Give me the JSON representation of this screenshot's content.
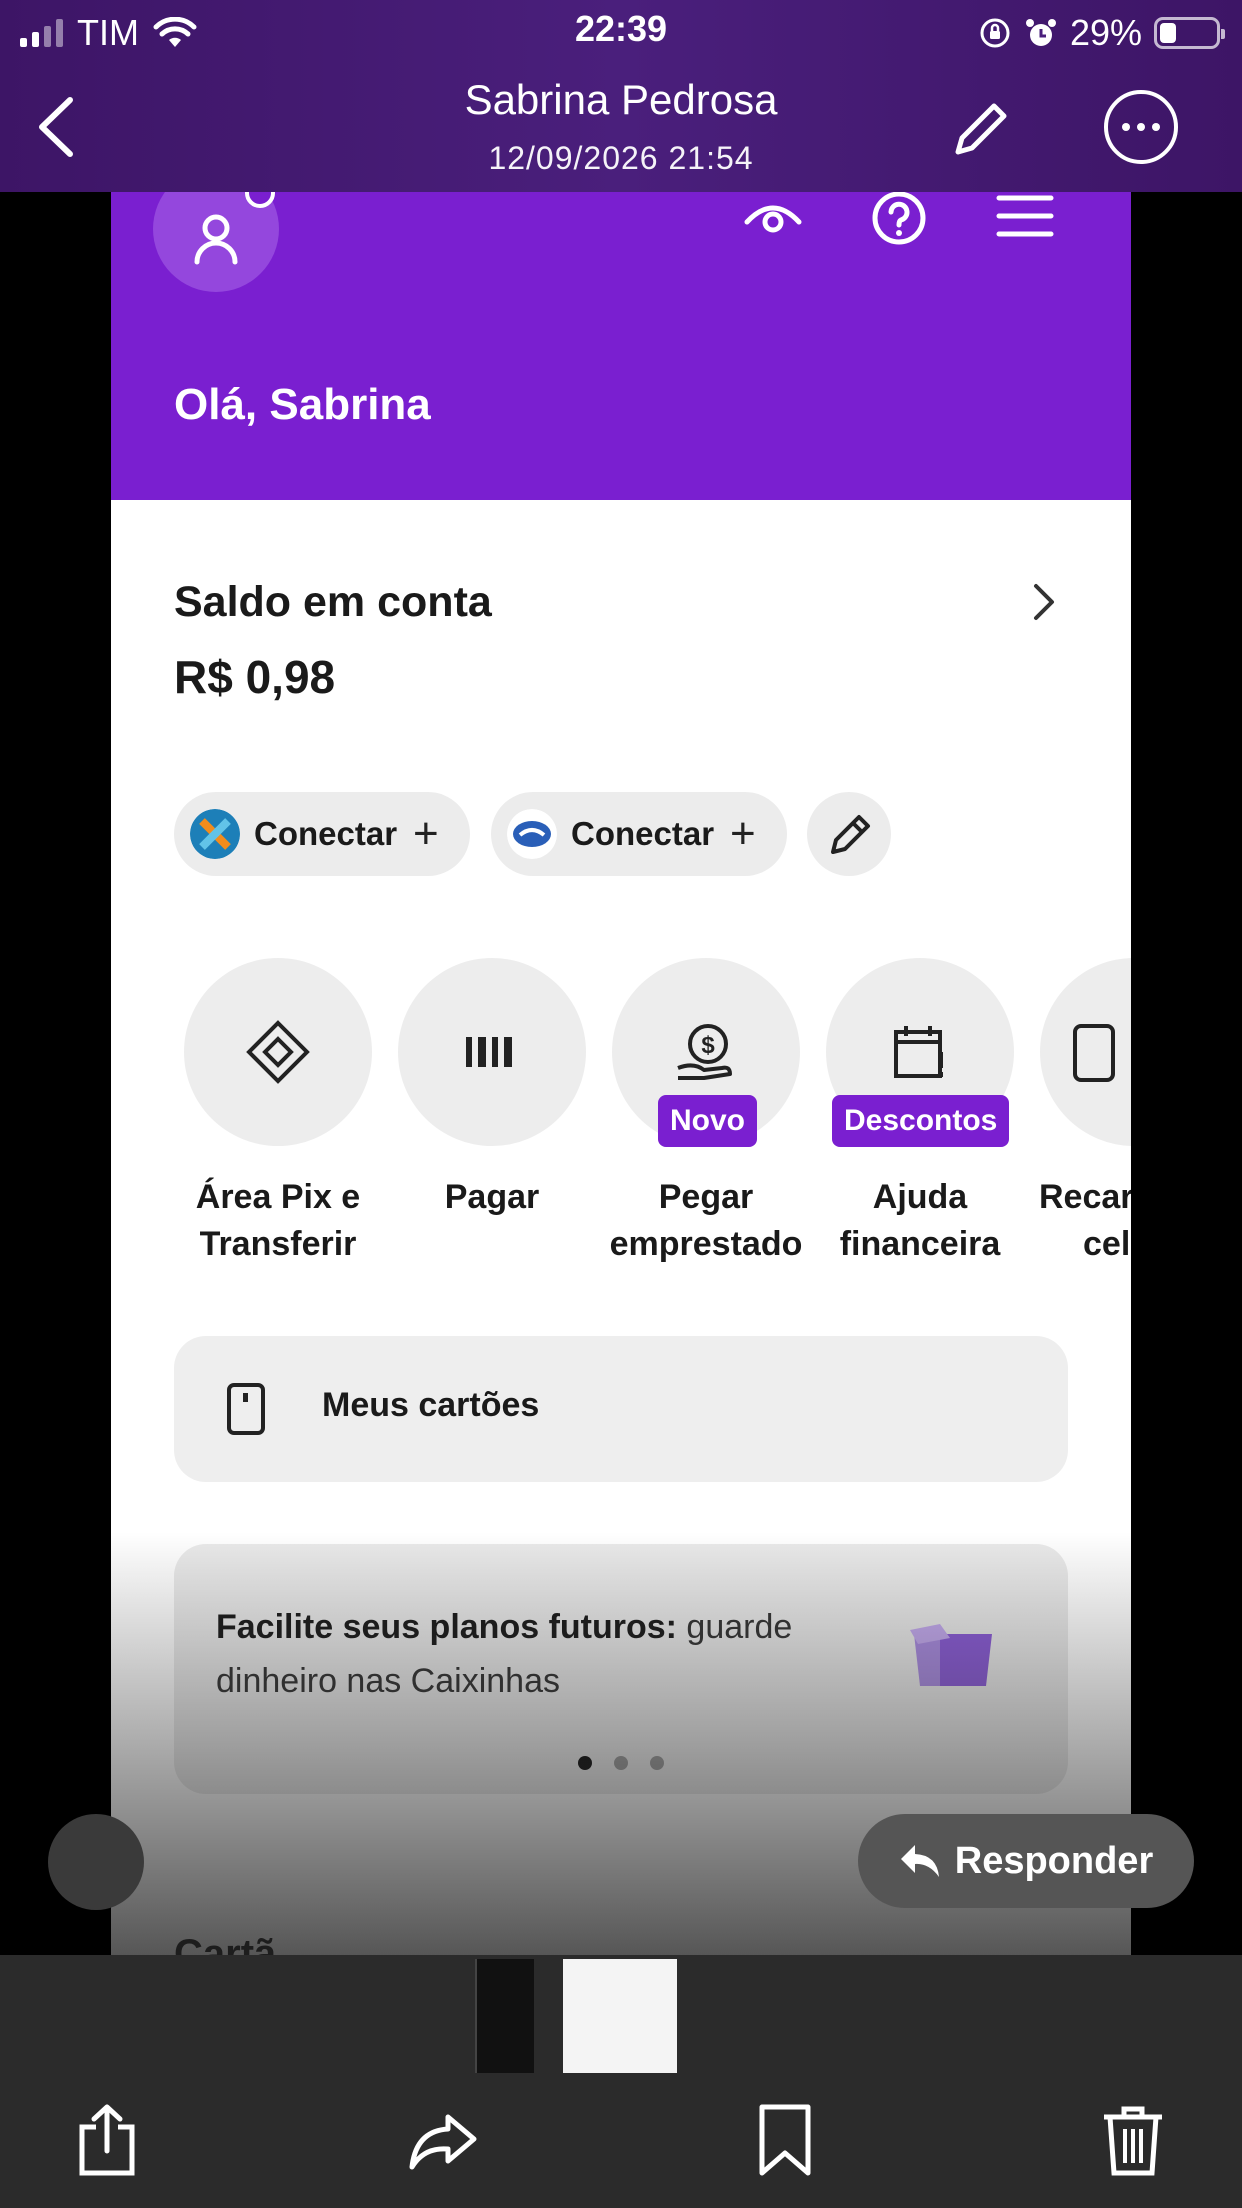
{
  "status_bar": {
    "carrier": "TIM",
    "time": "22:39",
    "battery_percent": "29%",
    "battery_level": 0.29
  },
  "viewer": {
    "contact_name": "Sabrina Pedrosa",
    "timestamp": "12/09/2026 21:54",
    "reply_label": "Responder"
  },
  "app": {
    "greeting": "Olá, Sabrina",
    "balance": {
      "title": "Saldo em conta",
      "value": "R$ 0,98"
    },
    "connect_chips": [
      {
        "label": "Conectar",
        "logo": "caixa-logo-icon"
      },
      {
        "label": "Conectar",
        "logo": "bank-handshake-logo-icon"
      }
    ],
    "actions": [
      {
        "line1": "Área Pix e",
        "line2": "Transferir",
        "icon": "pix-icon",
        "tag": ""
      },
      {
        "line1": "Pagar",
        "line2": "",
        "icon": "barcode-icon",
        "tag": ""
      },
      {
        "line1": "Pegar",
        "line2": "emprestado",
        "icon": "money-hand-icon",
        "tag": "Novo"
      },
      {
        "line1": "Ajuda",
        "line2": "financeira",
        "icon": "calendar-alert-icon",
        "tag": "Descontos"
      },
      {
        "line1": "Recar",
        "line2": "cel",
        "icon": "phone-icon",
        "tag": ""
      }
    ],
    "my_cards_label": "Meus cartões",
    "promo": {
      "bold": "Facilite seus planos futuros:",
      "rest": " guarde dinheiro nas Caixinhas",
      "active_dot": 1,
      "dot_count": 3
    },
    "next_section": "Cartã"
  },
  "colors": {
    "brand_purple": "#7a1fd0",
    "viewer_purple": "#4a1f7c"
  }
}
